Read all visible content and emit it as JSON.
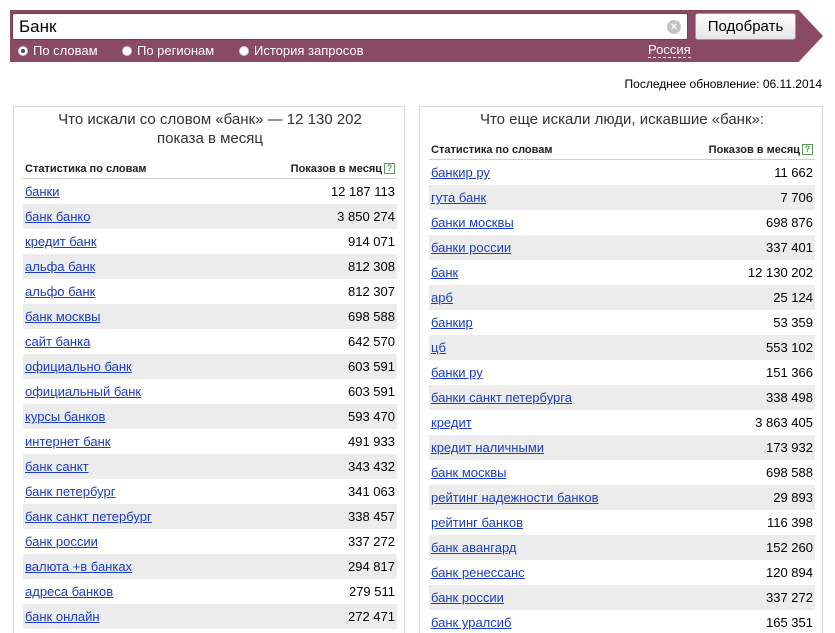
{
  "search": {
    "value": "Банк",
    "clear_icon": "×",
    "submit_label": "Подобрать"
  },
  "modes": [
    {
      "label": "По словам",
      "checked": true
    },
    {
      "label": "По регионам",
      "checked": false
    },
    {
      "label": "История запросов",
      "checked": false
    }
  ],
  "region": "Россия",
  "last_update": "Последнее обновление: 06.11.2014",
  "left_panel": {
    "title": "Что искали со словом «банк» — 12 130 202 показа в месяц",
    "col_keyword": "Статистика по словам",
    "col_count": "Показов в месяц",
    "help": "?",
    "rows": [
      {
        "keyword": "банки",
        "count": "12 187 113"
      },
      {
        "keyword": "банк банко",
        "count": "3 850 274"
      },
      {
        "keyword": "кредит банк",
        "count": "914 071"
      },
      {
        "keyword": "альфа банк",
        "count": "812 308"
      },
      {
        "keyword": "альфо банк",
        "count": "812 307"
      },
      {
        "keyword": "банк москвы",
        "count": "698 588"
      },
      {
        "keyword": "сайт банка",
        "count": "642 570"
      },
      {
        "keyword": "официально банк",
        "count": "603 591"
      },
      {
        "keyword": "официальный банк",
        "count": "603 591"
      },
      {
        "keyword": "курсы банков",
        "count": "593 470"
      },
      {
        "keyword": "интернет банк",
        "count": "491 933"
      },
      {
        "keyword": "банк санкт",
        "count": "343 432"
      },
      {
        "keyword": "банк петербург",
        "count": "341 063"
      },
      {
        "keyword": "банк санкт петербург",
        "count": "338 457"
      },
      {
        "keyword": "банк россии",
        "count": "337 272"
      },
      {
        "keyword": "валюта +в банках",
        "count": "294 817"
      },
      {
        "keyword": "адреса банков",
        "count": "279 511"
      },
      {
        "keyword": "банк онлайн",
        "count": "272 471"
      }
    ]
  },
  "right_panel": {
    "title": "Что еще искали люди, искавшие «банк»:",
    "col_keyword": "Статистика по словам",
    "col_count": "Показов в месяц",
    "help": "?",
    "rows": [
      {
        "keyword": "банкир ру",
        "count": "11 662"
      },
      {
        "keyword": "гута банк",
        "count": "7 706"
      },
      {
        "keyword": "банки москвы",
        "count": "698 876"
      },
      {
        "keyword": "банки россии",
        "count": "337 401"
      },
      {
        "keyword": "банк",
        "count": "12 130 202"
      },
      {
        "keyword": "арб",
        "count": "25 124"
      },
      {
        "keyword": "банкир",
        "count": "53 359"
      },
      {
        "keyword": "цб",
        "count": "553 102"
      },
      {
        "keyword": "банки ру",
        "count": "151 366"
      },
      {
        "keyword": "банки санкт петербурга",
        "count": "338 498"
      },
      {
        "keyword": "кредит",
        "count": "3 863 405"
      },
      {
        "keyword": "кредит наличными",
        "count": "173 932"
      },
      {
        "keyword": "банк москвы",
        "count": "698 588"
      },
      {
        "keyword": "рейтинг надежности банков",
        "count": "29 893"
      },
      {
        "keyword": "рейтинг банков",
        "count": "116 398"
      },
      {
        "keyword": "банк авангард",
        "count": "152 260"
      },
      {
        "keyword": "банк ренессанс",
        "count": "120 894"
      },
      {
        "keyword": "банк россии",
        "count": "337 272"
      },
      {
        "keyword": "банк уралсиб",
        "count": "165 351"
      }
    ]
  }
}
